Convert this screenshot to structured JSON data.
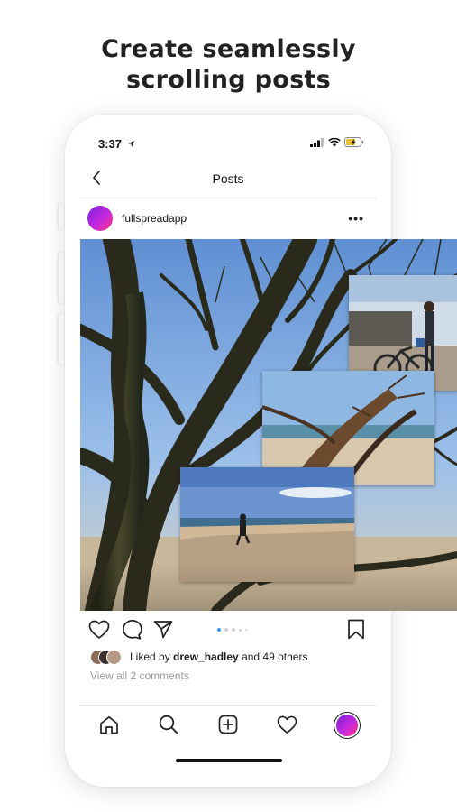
{
  "headline": {
    "line1": "Create seamlessly",
    "line2": "scrolling posts"
  },
  "status_bar": {
    "time": "3:37",
    "location_icon": "location-arrow-icon",
    "signal_icon": "cellular-signal-icon",
    "wifi_icon": "wifi-icon",
    "battery_icon": "battery-charging-icon",
    "battery_color": "#e8c13a"
  },
  "nav": {
    "back_icon": "chevron-left-icon",
    "title": "Posts"
  },
  "post": {
    "username": "fullspreadapp",
    "more_icon": "more-dots-icon",
    "avatar_gradient": [
      "#7b1fd8",
      "#c42ae0",
      "#ff2f7a"
    ],
    "photo_description_icons": [
      "tree-branches-photo",
      "bicycle-photo",
      "beach-driftwood-photo",
      "beach-runner-photo"
    ],
    "actions": {
      "like_icon": "heart-icon",
      "comment_icon": "comment-bubble-icon",
      "share_icon": "paper-plane-icon",
      "save_icon": "bookmark-icon"
    },
    "carousel": {
      "count": 5,
      "active_index": 0,
      "active_color": "#3b95f0"
    },
    "likes": {
      "prefix": "Liked by ",
      "user": "drew_hadley",
      "suffix": " and 49 others"
    },
    "comments": "View all 2 comments"
  },
  "tab_bar": {
    "items": [
      {
        "name": "home",
        "icon": "home-icon"
      },
      {
        "name": "search",
        "icon": "search-icon"
      },
      {
        "name": "create",
        "icon": "plus-square-icon"
      },
      {
        "name": "activity",
        "icon": "heart-icon"
      },
      {
        "name": "profile",
        "icon": "profile-avatar-icon"
      }
    ]
  }
}
